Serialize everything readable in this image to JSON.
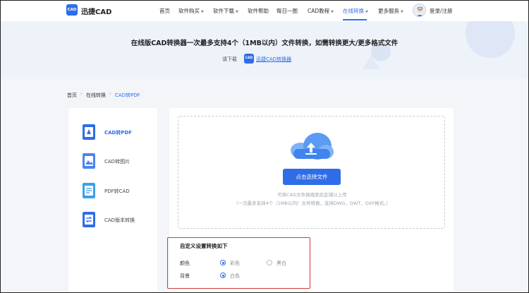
{
  "header": {
    "logo_badge": "CAD",
    "logo_text": "迅捷CAD",
    "nav": [
      {
        "label": "首页",
        "dropdown": false,
        "active": false
      },
      {
        "label": "软件购买",
        "dropdown": true,
        "active": false
      },
      {
        "label": "软件下载",
        "dropdown": true,
        "active": false
      },
      {
        "label": "软件帮助",
        "dropdown": false,
        "active": false
      },
      {
        "label": "每日一图",
        "dropdown": false,
        "active": false
      },
      {
        "label": "CAD教程",
        "dropdown": true,
        "active": false
      },
      {
        "label": "在线转换",
        "dropdown": true,
        "active": true
      },
      {
        "label": "更多服务",
        "dropdown": true,
        "active": false
      }
    ],
    "login": "登录/注册"
  },
  "banner": {
    "title": "在线版CAD转换器一次最多支持4个（1MB以内）文件转换，如需转换更大/更多格式文件",
    "download_label": "请下载",
    "download_badge": "CAD",
    "download_link": "迅捷CAD转换器"
  },
  "breadcrumb": [
    "首页",
    "在线转换",
    "CAD转PDF"
  ],
  "sidebar": {
    "items": [
      {
        "label": "CAD转PDF",
        "active": true
      },
      {
        "label": "CAD转图片",
        "active": false
      },
      {
        "label": "PDF转CAD",
        "active": false
      },
      {
        "label": "CAD版本转换",
        "active": false
      }
    ]
  },
  "upload": {
    "button": "点击选择文件",
    "hint1": "可将CAD文件拖拽至此区域以上传",
    "hint2": "（一次最多支持4个（1MB以内）文件转换，支持DWG、DWT、DXF格式。）"
  },
  "settings": {
    "title": "自定义设置转换如下",
    "color_label": "颜色",
    "color_options": [
      "彩色",
      "黑白"
    ],
    "color_selected": "彩色",
    "bg_label": "背景",
    "bg_options": [
      "白色"
    ],
    "bg_selected": "白色"
  },
  "colors": {
    "accent": "#2f6de8",
    "highlight_box": "#d23a3a"
  }
}
